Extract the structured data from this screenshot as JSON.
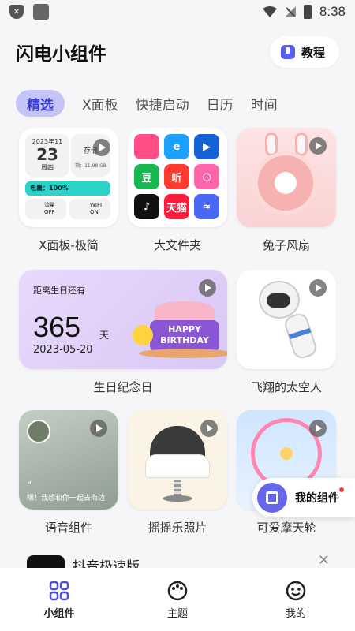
{
  "status_bar": {
    "time": "8:38"
  },
  "header": {
    "title": "闪电小组件",
    "tutorial_label": "教程"
  },
  "tabs": [
    {
      "label": "精选",
      "active": true
    },
    {
      "label": "X面板"
    },
    {
      "label": "快捷启动"
    },
    {
      "label": "日历"
    },
    {
      "label": "时间"
    }
  ],
  "widgets": {
    "xpanel": {
      "label": "X面板-极简",
      "date_header": "2023年11",
      "day": "23",
      "weekday": "周四",
      "storage_title": "存储",
      "storage_remaining": "剩：11.98 GB",
      "battery": "电量：100%",
      "flow_label": "流量",
      "flow_state": "OFF",
      "wifi_label": "WIFI",
      "wifi_state": "ON"
    },
    "folder": {
      "label": "大文件夹",
      "apps": [
        {
          "text": "",
          "color": "#ff4f86"
        },
        {
          "text": "e",
          "color": "#1ea0ff"
        },
        {
          "text": "▶",
          "color": "#1661d6"
        },
        {
          "text": "豆",
          "color": "#17b84f"
        },
        {
          "text": "听",
          "color": "#ff3b30"
        },
        {
          "text": "○",
          "color": "#ff66aa"
        },
        {
          "text": "♪",
          "color": "#111111"
        },
        {
          "text": "天猫",
          "color": "#ff1b3b"
        },
        {
          "text": "≈",
          "color": "#4a67f5"
        }
      ]
    },
    "fan": {
      "label": "兔子风扇"
    },
    "birthday": {
      "label": "生日纪念日",
      "title": "距离生日还有",
      "days": "365",
      "unit": "天",
      "date": "2023-05-20",
      "cake_text_1": "HAPPY",
      "cake_text_2": "BIRTHDAY"
    },
    "astronaut": {
      "label": "飞翔的太空人"
    },
    "voice": {
      "label": "语音组件",
      "quote": "“",
      "text": "嘿！我想和你一起去海边"
    },
    "photo": {
      "label": "摇摇乐照片"
    },
    "ferris": {
      "label": "可爱摩天轮"
    }
  },
  "floating": {
    "my_widgets_label": "我的组件"
  },
  "ad": {
    "title": "抖音极速版"
  },
  "bottom_nav": [
    {
      "label": "小组件",
      "icon": "grid-icon",
      "active": true
    },
    {
      "label": "主题",
      "icon": "palette-icon"
    },
    {
      "label": "我的",
      "icon": "smile-icon"
    }
  ]
}
